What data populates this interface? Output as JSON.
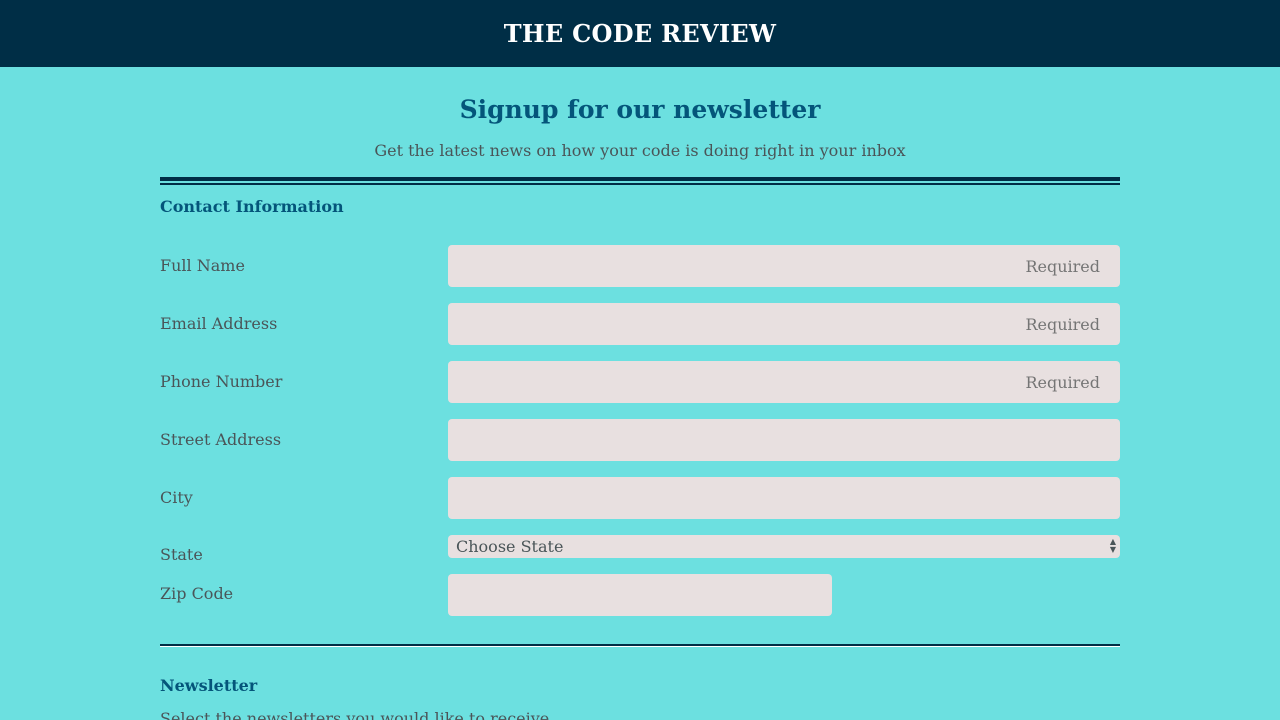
{
  "header": {
    "brand": "THE CODE REVIEW"
  },
  "hero": {
    "title": "Signup for our newsletter",
    "subtitle": "Get the latest news on how your code is doing right in your inbox"
  },
  "contact": {
    "section_title": "Contact Information",
    "full_name": {
      "label": "Full Name",
      "placeholder": "Required",
      "value": ""
    },
    "email": {
      "label": "Email Address",
      "placeholder": "Required",
      "value": ""
    },
    "phone": {
      "label": "Phone Number",
      "placeholder": "Required",
      "value": ""
    },
    "street": {
      "label": "Street Address",
      "placeholder": "",
      "value": ""
    },
    "city": {
      "label": "City",
      "placeholder": "",
      "value": ""
    },
    "state": {
      "label": "State",
      "selected": "Choose State"
    },
    "zip": {
      "label": "Zip Code",
      "placeholder": "",
      "value": ""
    }
  },
  "newsletter": {
    "section_title": "Newsletter",
    "description": "Select the newsletters you would like to receive"
  },
  "colors": {
    "background": "#6ce0e0",
    "topbar": "#002e46",
    "accent": "#04557a",
    "input_bg": "#e8e0e0",
    "text": "#4a5558"
  }
}
